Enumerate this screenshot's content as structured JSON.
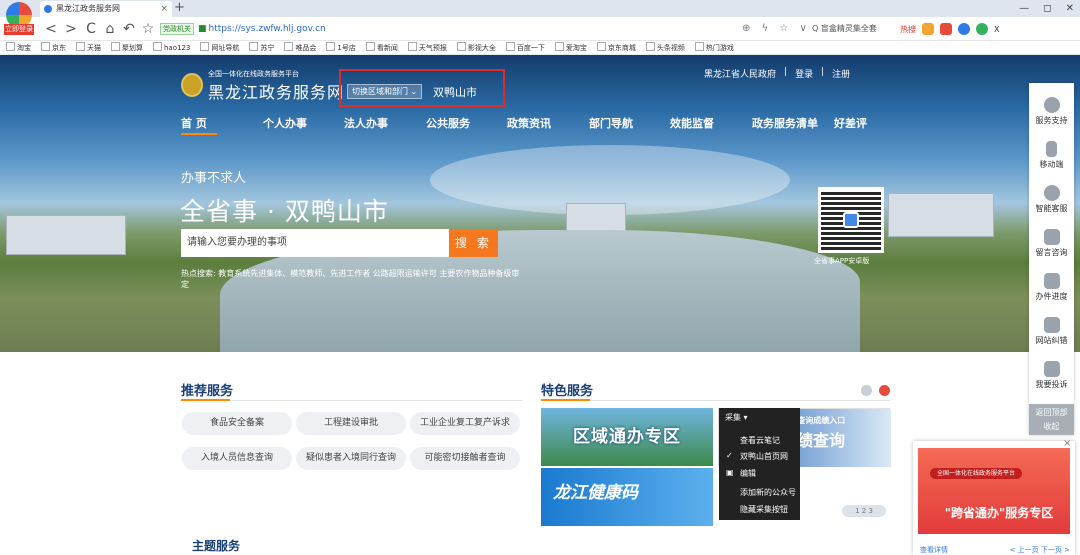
{
  "browser": {
    "login_badge": "立即登录",
    "tab_title": "黑龙江政务服务网",
    "new_tab": "+",
    "url_gov_badge": "党政机关",
    "url": "https://sys.zwfw.hlj.gov.cn",
    "search_box": "盲盒精灵集全套",
    "nav_back": "<",
    "nav_forward": ">",
    "nav_reload": "C",
    "nav_home": "⌂",
    "nav_undo": "↶",
    "nav_star": "☆",
    "url_icons": "⊕ ϟ ☆ ∨",
    "search_icon": "Q",
    "window_min": "—",
    "window_max": "◻",
    "window_close": "✕",
    "toolbar_hot": "热搜",
    "toolbar_x": "X",
    "bookmarks": [
      "淘宝",
      "京东",
      "天猫",
      "聚划算",
      "hao123",
      "网址导航",
      "苏宁",
      "唯品会",
      "1号店",
      "看新闻",
      "天气预报",
      "影视大全",
      "百度一下",
      "爱淘宝",
      "京东商城",
      "头条视频",
      "热门游戏"
    ]
  },
  "site": {
    "brand_small": "全国一体化在线政务服务平台",
    "brand": "黑龙江政务服务网",
    "region_button": "切换区域和部门",
    "region_name": "双鸭山市",
    "toplinks": [
      "黑龙江省人民政府",
      "|",
      "登录",
      "|",
      "注册"
    ],
    "nav": [
      "首 页",
      "个人办事",
      "法人办事",
      "公共服务",
      "政策资讯",
      "部门导航",
      "效能监督",
      "政务服务清单",
      "好差评"
    ],
    "slogan": "办事不求人",
    "big_title": "全省事 · 双鸭山市",
    "search_placeholder": "请输入您要办理的事项",
    "search_button": "搜 索",
    "hot_search": "热点搜索: 教育系统先进集体、模范教师、先进工作者  公路超限运输许可  主要农作物品种备级审定",
    "qr_label": "全省事APP安卓版"
  },
  "rail": {
    "items": [
      "服务支持",
      "移动端",
      "智能客服",
      "留言咨询",
      "办件进度",
      "网站纠错",
      "我要投诉"
    ],
    "back_top": "返回顶部",
    "collapse": "收起"
  },
  "recommend": {
    "title": "推荐服务",
    "items": [
      "食品安全备案",
      "工程建设审批",
      "工业企业复工复产诉求",
      "入境人员信息查询",
      "疑似患者入境同行查询",
      "可能密切接触者查询"
    ]
  },
  "featured": {
    "title": "特色服务",
    "tile1": "区域通办专区",
    "tile2": "龙江健康码",
    "tile3_top": "2020高考查询成绩入口",
    "tile3_main": "成绩查询",
    "pager": "1 2 3"
  },
  "context_menu": {
    "header": "采集",
    "items": [
      "查看云笔记",
      "双鸭山首页网",
      "编辑",
      "添加新的公众号",
      "隐藏采集按钮"
    ],
    "check": "✓"
  },
  "ad": {
    "pill": "全国一体化在线政务服务平台",
    "text": "\"跨省通办\"服务专区",
    "more": "查看详情",
    "pages": "< 上一页 下一页 >",
    "close": "×"
  },
  "theme": {
    "title": "主题服务"
  },
  "colors": {
    "accent": "#ff8a00",
    "brand_blue": "#1a3f7a",
    "highlight_red": "#e02b2b"
  }
}
